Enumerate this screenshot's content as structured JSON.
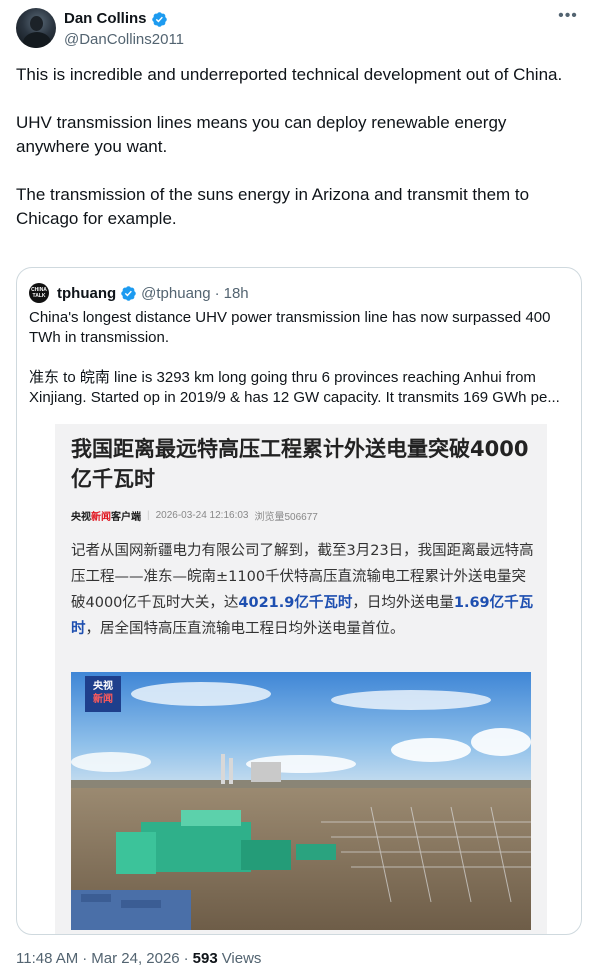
{
  "author": {
    "display_name": "Dan Collins",
    "handle": "@DanCollins2011",
    "more_icon": "more-horizontal-icon",
    "verified_icon": "verified-badge-icon"
  },
  "tweet": {
    "paragraphs": [
      "This is incredible and underreported technical development out of China.",
      "UHV transmission lines means you can deploy renewable energy anywhere you want.",
      "The transmission of the suns energy in Arizona and transmit them to Chicago for example."
    ]
  },
  "quote": {
    "avatar_text": "CHINA TALK",
    "display_name": "tphuang",
    "handle": "@tphuang",
    "separator": "·",
    "time": "18h",
    "line1": "China's longest distance UHV power transmission line has now surpassed 400 TWh in transmission.",
    "line2": "准东 to 皖南 line is 3293 km long going thru 6 provinces reaching Anhui from Xinjiang. Started op in 2019/9 & has 12 GW capacity. It transmits 169 GWh pe..."
  },
  "news_card": {
    "title": "我国距离最远特高压工程累计外送电量突破4000亿千瓦时",
    "source_a": "央视",
    "source_b": "新闻",
    "source_c": "客户端",
    "meta_date": "2026-03-24 12:16:03",
    "meta_views": "浏览量506677",
    "body_part1": "记者从国网新疆电力有限公司了解到，截至3月23日，我国距离最远特高压工程——准东—皖南±1100千伏特高压直流输电工程累计外送电量突破4000亿千瓦时大关，达",
    "body_hl1": "4021.9亿千瓦时",
    "body_part2": "，日均外送电量",
    "body_hl2": "1.69亿千瓦时",
    "body_part3": "，居全国特高压直流输电工程日均外送电量首位。",
    "logo_line1": "央视",
    "logo_line2": "新闻"
  },
  "footer": {
    "time": "11:48 AM",
    "separator1": "·",
    "date": "Mar 24, 2026",
    "separator2": "·",
    "views_count": "593",
    "views_label": "Views"
  }
}
